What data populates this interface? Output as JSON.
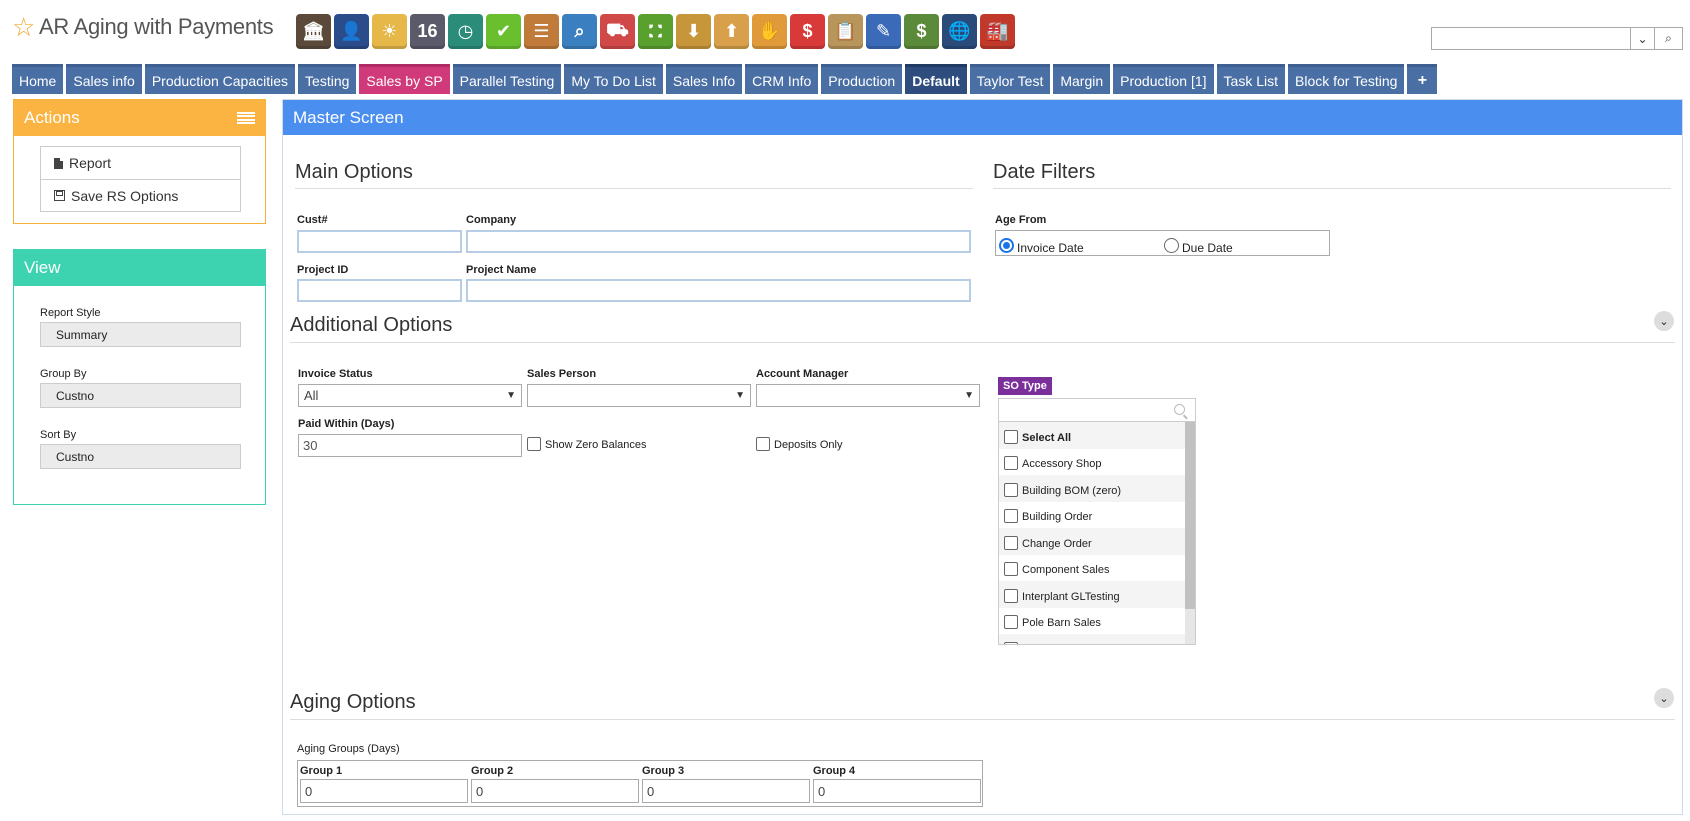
{
  "header": {
    "title": "AR Aging with Payments",
    "star_icon": "star-outline-icon"
  },
  "toolbar": {
    "icons": [
      {
        "name": "bank-icon",
        "glyph": "🏛",
        "color": "#5b4a3a"
      },
      {
        "name": "user-icon",
        "glyph": "👤",
        "color": "#2b4c8a"
      },
      {
        "name": "weather-icon",
        "glyph": "☀",
        "color": "#e6b84a"
      },
      {
        "name": "calendar-icon",
        "glyph": "16",
        "color": "#5a5a6a"
      },
      {
        "name": "clock-icon",
        "glyph": "◷",
        "color": "#2b8c7a"
      },
      {
        "name": "checkmark-icon",
        "glyph": "✔",
        "color": "#6abf2f"
      },
      {
        "name": "list-icon",
        "glyph": "☰",
        "color": "#c07a3a"
      },
      {
        "name": "magnifier-icon",
        "glyph": "⌕",
        "color": "#3a7fc0"
      },
      {
        "name": "truck-icon",
        "glyph": "⛟",
        "color": "#d04848"
      },
      {
        "name": "basket-icon",
        "glyph": "⛚",
        "color": "#5aa02f"
      },
      {
        "name": "download-box-icon",
        "glyph": "⬇",
        "color": "#c8963a"
      },
      {
        "name": "upload-box-icon",
        "glyph": "⬆",
        "color": "#d8a04a"
      },
      {
        "name": "hand-money-icon",
        "glyph": "✋",
        "color": "#e09a3a"
      },
      {
        "name": "dollar-bubble-icon",
        "glyph": "$",
        "color": "#d83a3a"
      },
      {
        "name": "clipboard-icon",
        "glyph": "📋",
        "color": "#b8955a"
      },
      {
        "name": "pencil-icon",
        "glyph": "✎",
        "color": "#3a6ab8"
      },
      {
        "name": "cash-icon",
        "glyph": "$",
        "color": "#5a8a3a"
      },
      {
        "name": "phone-globe-icon",
        "glyph": "🌐",
        "color": "#2a4a7a"
      },
      {
        "name": "factory-icon",
        "glyph": "🏭",
        "color": "#c0392b"
      }
    ]
  },
  "search": {
    "placeholder": "",
    "value": ""
  },
  "tabs": [
    {
      "label": "Home",
      "style": ""
    },
    {
      "label": "Sales info",
      "style": ""
    },
    {
      "label": "Production Capacities",
      "style": ""
    },
    {
      "label": "Testing",
      "style": ""
    },
    {
      "label": "Sales by SP",
      "style": "pink"
    },
    {
      "label": "Parallel Testing",
      "style": ""
    },
    {
      "label": "My To Do List",
      "style": ""
    },
    {
      "label": "Sales Info",
      "style": ""
    },
    {
      "label": "CRM Info",
      "style": ""
    },
    {
      "label": "Production",
      "style": ""
    },
    {
      "label": "Default",
      "style": "active"
    },
    {
      "label": "Taylor Test",
      "style": ""
    },
    {
      "label": "Margin",
      "style": ""
    },
    {
      "label": "Production [1]",
      "style": ""
    },
    {
      "label": "Task List",
      "style": ""
    },
    {
      "label": "Block for Testing",
      "style": ""
    }
  ],
  "tab_plus": "+",
  "actions": {
    "title": "Actions",
    "items": [
      "Report",
      "Save RS Options"
    ]
  },
  "view": {
    "title": "View",
    "report_style_label": "Report Style",
    "report_style_value": "Summary",
    "group_by_label": "Group By",
    "group_by_value": "Custno",
    "sort_by_label": "Sort By",
    "sort_by_value": "Custno"
  },
  "master": {
    "title": "Master Screen",
    "main_options": {
      "title": "Main Options",
      "cust_label": "Cust#",
      "cust_value": "",
      "company_label": "Company",
      "company_value": "",
      "project_id_label": "Project ID",
      "project_id_value": "",
      "project_name_label": "Project Name",
      "project_name_value": ""
    },
    "date_filters": {
      "title": "Date Filters",
      "age_from_label": "Age From",
      "options": [
        "Invoice Date",
        "Due Date"
      ],
      "selected": "Invoice Date"
    },
    "additional_options": {
      "title": "Additional Options",
      "invoice_status_label": "Invoice Status",
      "invoice_status_value": "All",
      "sales_person_label": "Sales Person",
      "sales_person_value": "",
      "account_manager_label": "Account Manager",
      "account_manager_value": "",
      "paid_within_label": "Paid Within (Days)",
      "paid_within_value": "30",
      "show_zero_label": "Show Zero Balances",
      "deposits_only_label": "Deposits Only",
      "so_type_label": "SO Type",
      "so_type_items": [
        "Select All",
        "Accessory Shop",
        "Building BOM (zero)",
        "Building Order",
        "Change Order",
        "Component Sales",
        "Interplant GLTesting",
        "Pole Barn Sales",
        ""
      ]
    },
    "aging_options": {
      "title": "Aging Options",
      "groups_label": "Aging Groups (Days)",
      "groups": [
        {
          "label": "Group 1",
          "value": "0"
        },
        {
          "label": "Group 2",
          "value": "0"
        },
        {
          "label": "Group 3",
          "value": "0"
        },
        {
          "label": "Group 4",
          "value": "0"
        }
      ]
    }
  }
}
